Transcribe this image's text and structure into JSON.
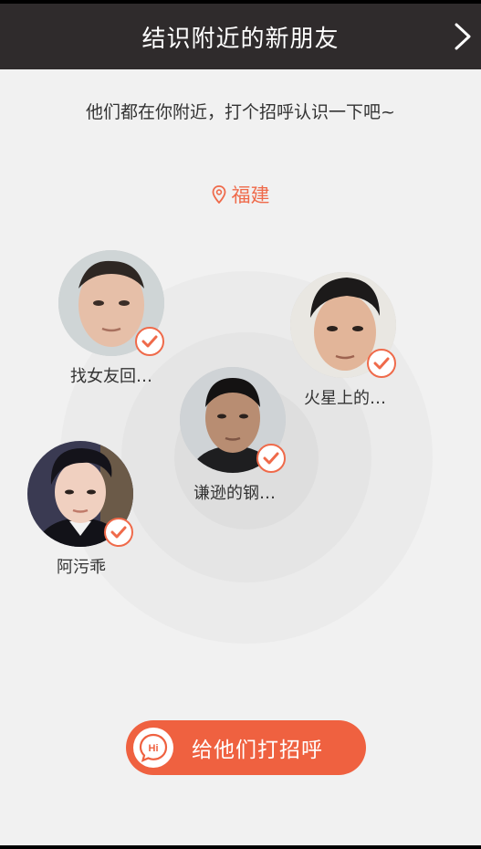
{
  "header": {
    "title": "结识附近的新朋友",
    "next_icon": "chevron-right-icon"
  },
  "subtitle": "他们都在你附近，打个招呼认识一下吧~",
  "location": {
    "icon": "location-pin-icon",
    "name": "福建"
  },
  "users": [
    {
      "name": "找女友回…",
      "selected": true
    },
    {
      "name": "火星上的…",
      "selected": true
    },
    {
      "name": "谦逊的钢…",
      "selected": true
    },
    {
      "name": "阿污乖",
      "selected": true
    }
  ],
  "greet_button": {
    "label": "给他们打招呼",
    "badge_text": "Hi",
    "icon": "hi-speech-bubble-icon"
  },
  "colors": {
    "accent": "#ef6140",
    "header_bg": "#2f2b2c",
    "page_bg": "#f1f1f1"
  }
}
